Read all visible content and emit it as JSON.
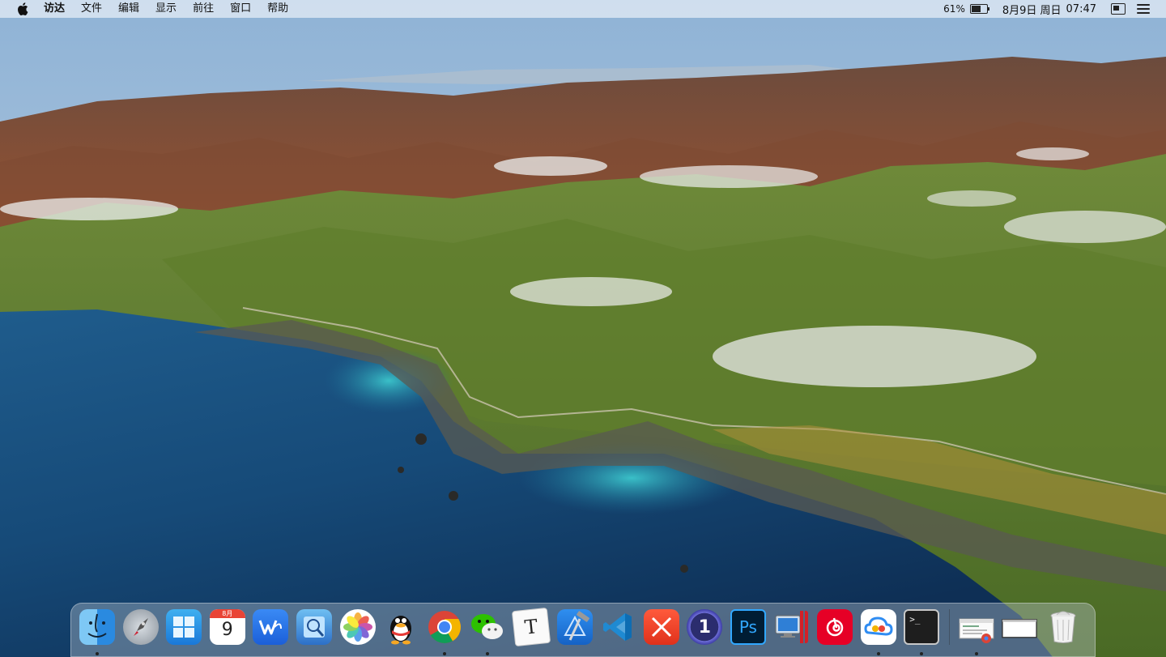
{
  "menubar": {
    "app_name": "访达",
    "items": [
      "文件",
      "编辑",
      "显示",
      "前往",
      "窗口",
      "帮助"
    ],
    "battery_percent": "61%",
    "battery_level": 0.61,
    "date": "8月9日 周日",
    "time": "07:47"
  },
  "dock": {
    "calendar_month": "8月",
    "calendar_day": "9",
    "typora_letter": "T",
    "ps_label": "Ps",
    "onepassword_label": "1",
    "terminal_prompt": ">_",
    "items": [
      {
        "name": "finder-icon",
        "running": true
      },
      {
        "name": "launchpad-icon",
        "running": false
      },
      {
        "name": "windows-icon",
        "running": false
      },
      {
        "name": "calendar-icon",
        "running": false
      },
      {
        "name": "wps-icon",
        "running": false
      },
      {
        "name": "preview-icon",
        "running": false
      },
      {
        "name": "photos-icon",
        "running": false
      },
      {
        "name": "qq-icon",
        "running": false
      },
      {
        "name": "chrome-icon",
        "running": true
      },
      {
        "name": "wechat-icon",
        "running": true
      },
      {
        "name": "typora-icon",
        "running": false
      },
      {
        "name": "xcode-icon",
        "running": false
      },
      {
        "name": "vscode-icon",
        "running": false
      },
      {
        "name": "xmind-icon",
        "running": false
      },
      {
        "name": "onepassword-icon",
        "running": false
      },
      {
        "name": "photoshop-icon",
        "running": false
      },
      {
        "name": "parallels-icon",
        "running": false
      },
      {
        "name": "netease-music-icon",
        "running": false
      },
      {
        "name": "baidu-netdisk-icon",
        "running": true
      },
      {
        "name": "terminal-icon",
        "running": true
      }
    ],
    "recent_items": [
      {
        "name": "chrome-window-icon",
        "running": true
      },
      {
        "name": "blank-window-icon",
        "running": false
      },
      {
        "name": "trash-icon",
        "running": false
      }
    ]
  },
  "colors": {
    "sky_top": "#7fa6c9",
    "ocean_deep": "#123b66",
    "ocean_shallow": "#2aa3b8",
    "hills_green": "#5c7a2e",
    "mountains_rust": "#8a4a2e"
  }
}
